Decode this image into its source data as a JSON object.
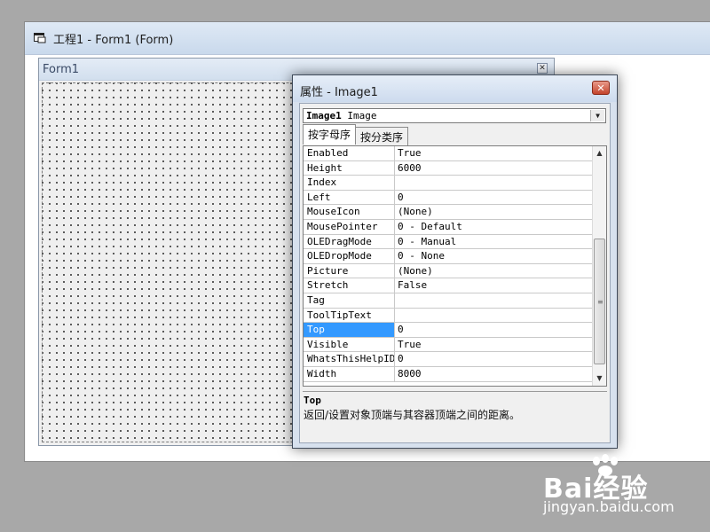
{
  "project_window": {
    "title": "工程1 - Form1 (Form)"
  },
  "form1": {
    "title": "Form1",
    "close_glyph": "✕"
  },
  "properties": {
    "title": "属性 - Image1",
    "close_glyph": "✕",
    "object_name": "Image1",
    "object_type": "Image",
    "tabs": [
      "按字母序",
      "按分类序"
    ],
    "rows": [
      {
        "name": "Enabled",
        "value": "True"
      },
      {
        "name": "Height",
        "value": "6000"
      },
      {
        "name": "Index",
        "value": ""
      },
      {
        "name": "Left",
        "value": "0"
      },
      {
        "name": "MouseIcon",
        "value": "(None)"
      },
      {
        "name": "MousePointer",
        "value": "0 - Default"
      },
      {
        "name": "OLEDragMode",
        "value": "0 - Manual"
      },
      {
        "name": "OLEDropMode",
        "value": "0 - None"
      },
      {
        "name": "Picture",
        "value": "(None)"
      },
      {
        "name": "Stretch",
        "value": "False"
      },
      {
        "name": "Tag",
        "value": ""
      },
      {
        "name": "ToolTipText",
        "value": ""
      },
      {
        "name": "Top",
        "value": "0"
      },
      {
        "name": "Visible",
        "value": "True"
      },
      {
        "name": "WhatsThisHelpID",
        "value": "0"
      },
      {
        "name": "Width",
        "value": "8000"
      }
    ],
    "selected_row": "Top",
    "description_title": "Top",
    "description_text": "返回/设置对象顶端与其容器顶端之间的距离。"
  },
  "watermark": {
    "brand": "Bai经验",
    "url": "jingyan.baidu.com"
  },
  "colors": {
    "selection": "#3399ff",
    "close_red": "#c4442c"
  }
}
